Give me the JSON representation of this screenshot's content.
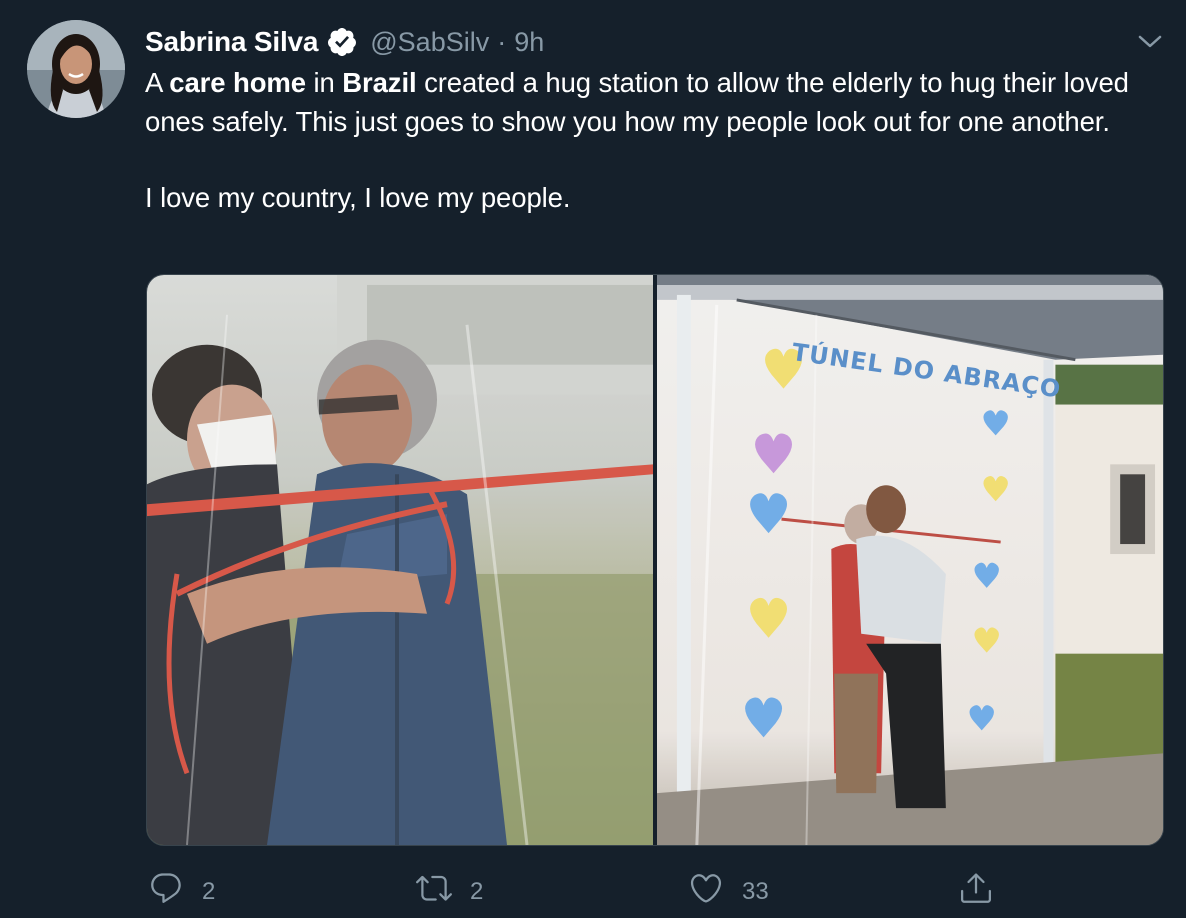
{
  "author": {
    "name": "Sabrina Silva",
    "handle": "@SabSilv",
    "separator": "·",
    "time": "9h",
    "avatar_icon": "profile-photo"
  },
  "tweet": {
    "line1_part1": "A ",
    "line1_bold1": "care home",
    "line1_part2": " in ",
    "line1_bold2": "Brazil",
    "line1_part3": " created a hug station to allow the elderly to hug their loved ones safely. This just goes to show you how my people look out for one another.",
    "line2": "I love my country, I love my people."
  },
  "media": {
    "sign_text": "TÚNEL DO ABRAÇO"
  },
  "actions": {
    "reply_count": "2",
    "retweet_count": "2",
    "like_count": "33"
  },
  "colors": {
    "background": "#15202b",
    "secondary_text": "#8899a6",
    "verified": "#ffffff"
  }
}
